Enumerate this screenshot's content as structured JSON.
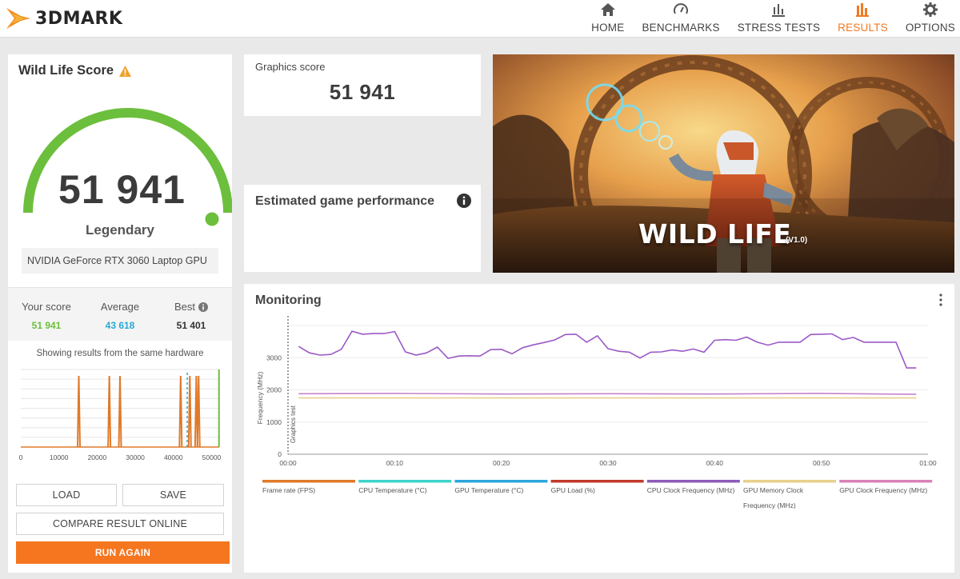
{
  "app": {
    "name": "3DMARK"
  },
  "nav": [
    {
      "label": "HOME",
      "icon": "home-icon",
      "active": false
    },
    {
      "label": "BENCHMARKS",
      "icon": "gauge-icon",
      "active": false
    },
    {
      "label": "STRESS TESTS",
      "icon": "stress-chart-icon",
      "active": false
    },
    {
      "label": "RESULTS",
      "icon": "bar-chart-icon",
      "active": true
    },
    {
      "label": "OPTIONS",
      "icon": "gear-icon",
      "active": false
    }
  ],
  "colors": {
    "accent": "#f5761f",
    "green": "#6cbf3c",
    "your_score": "#6cbf3c",
    "average": "#29a9d6",
    "best": "#333333"
  },
  "score_panel": {
    "title": "Wild Life Score",
    "score": "51 941",
    "tier": "Legendary",
    "gauge_fraction": 1.0,
    "gpu": "NVIDIA GeForce RTX 3060 Laptop GPU",
    "stats": {
      "your_score_label": "Your score",
      "your_score_value": "51 941",
      "average_label": "Average",
      "average_value": "43 618",
      "best_label": "Best",
      "best_value": "51 401"
    },
    "same_hardware_note": "Showing results from the same hardware",
    "histogram": {
      "x_ticks": [
        "0",
        "10000",
        "20000",
        "30000",
        "40000",
        "50000"
      ],
      "x_range": [
        0,
        52000
      ],
      "spikes": [
        15200,
        23200,
        26000,
        41900,
        44300,
        46000,
        46600
      ],
      "average_marker": 43618,
      "your_score_marker": 51941
    }
  },
  "buttons": {
    "load": "LOAD",
    "save": "SAVE",
    "compare": "COMPARE RESULT ONLINE",
    "run_again": "RUN AGAIN"
  },
  "graphics_score": {
    "label": "Graphics score",
    "value": "51 941"
  },
  "estimated_game_performance": {
    "title": "Estimated game performance"
  },
  "banner": {
    "title": "WILD LIFE",
    "version": "(V1.0)"
  },
  "monitoring": {
    "title": "Monitoring",
    "chart_data": {
      "type": "line",
      "ylabel": "Frequency (MHz)",
      "ylim": [
        0,
        4000
      ],
      "y_ticks": [
        0,
        1000,
        2000,
        3000
      ],
      "x_ticks": [
        "00:00",
        "00:10",
        "00:20",
        "00:30",
        "00:40",
        "00:50",
        "01:00"
      ],
      "x_range_seconds": [
        0,
        60
      ],
      "marker_label": "Graphics test",
      "marker_at_seconds": 0,
      "series": [
        {
          "name": "CPU Clock Frequency (MHz)",
          "color": "#9b59c6",
          "x": [
            1,
            2,
            3,
            4,
            5,
            6,
            7,
            8,
            9,
            10,
            11,
            12,
            13,
            14,
            15,
            16,
            17,
            18,
            19,
            20,
            21,
            22,
            23,
            24,
            25,
            26,
            27,
            28,
            29,
            30,
            31,
            32,
            33,
            34,
            35,
            36,
            37,
            38,
            39,
            40,
            41,
            42,
            43,
            44,
            45,
            46,
            47,
            48,
            49,
            50,
            51,
            52,
            53,
            54,
            55,
            56,
            57,
            58,
            58.9
          ],
          "values": [
            3350,
            3150,
            3080,
            3100,
            3260,
            3820,
            3730,
            3750,
            3750,
            3810,
            3180,
            3080,
            3150,
            3330,
            2980,
            3050,
            3060,
            3050,
            3250,
            3260,
            3120,
            3310,
            3400,
            3470,
            3550,
            3720,
            3730,
            3480,
            3680,
            3280,
            3200,
            3170,
            2990,
            3170,
            3180,
            3240,
            3200,
            3270,
            3170,
            3540,
            3560,
            3540,
            3640,
            3480,
            3390,
            3480,
            3480,
            3480,
            3720,
            3730,
            3740,
            3560,
            3630,
            3480,
            3480,
            3480,
            3480,
            2680,
            2680
          ]
        },
        {
          "name": "GPU Clock Frequency (MHz)",
          "color": "#c783c9",
          "x": [
            1,
            10,
            20,
            30,
            40,
            50,
            58.9
          ],
          "values": [
            1880,
            1890,
            1870,
            1880,
            1870,
            1890,
            1860
          ]
        },
        {
          "name": "GPU Memory Clock Frequency (MHz)",
          "color": "#e8cf8c",
          "x": [
            1,
            10,
            20,
            30,
            40,
            50,
            58.9
          ],
          "values": [
            1750,
            1750,
            1750,
            1750,
            1750,
            1750,
            1750
          ]
        }
      ],
      "legend": [
        {
          "name": "Frame rate (FPS)",
          "color": "#e07a2a"
        },
        {
          "name": "CPU Temperature (°C)",
          "color": "#3fd3c9"
        },
        {
          "name": "GPU Temperature (°C)",
          "color": "#2ea7dd"
        },
        {
          "name": "GPU Load (%)",
          "color": "#c0392b"
        },
        {
          "name": "CPU Clock Frequency (MHz)",
          "color": "#8e5cb8"
        },
        {
          "name": "GPU Memory Clock Frequency (MHz)",
          "color": "#e8cf8c"
        },
        {
          "name": "GPU Clock Frequency (MHz)",
          "color": "#d983b8"
        }
      ]
    }
  }
}
